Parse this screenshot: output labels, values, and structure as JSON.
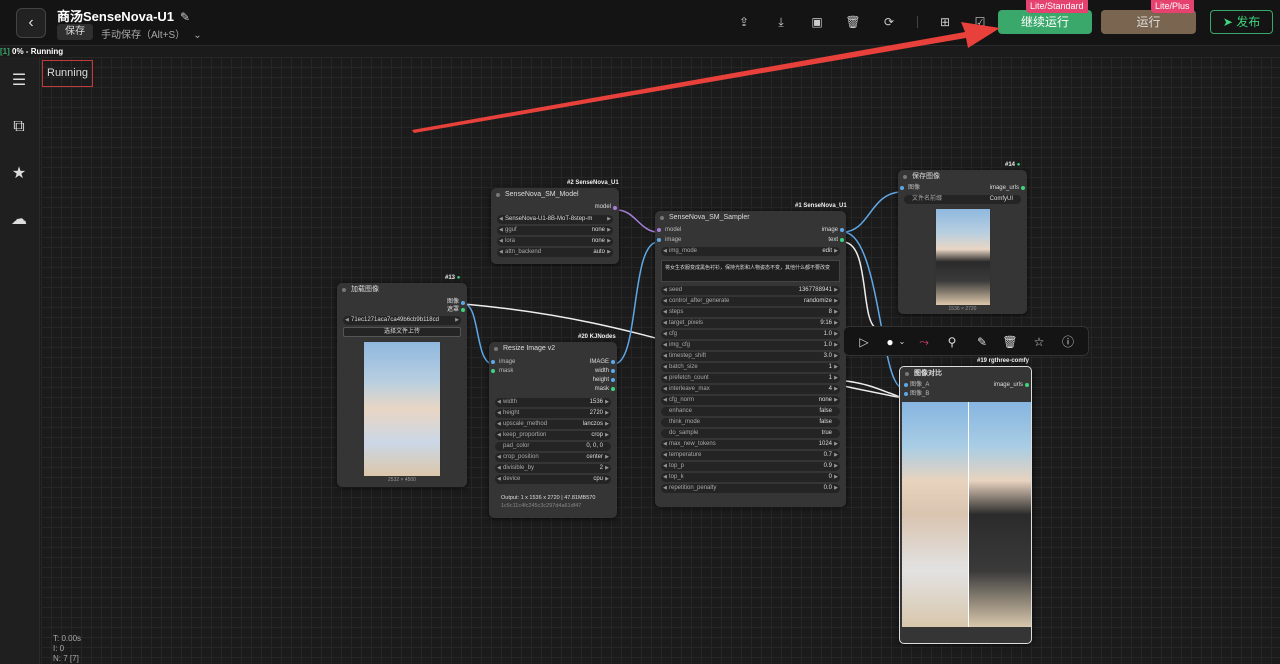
{
  "header": {
    "title": "商汤SenseNova-U1",
    "save_label": "保存",
    "save_hint": "手动保存（Alt+S）",
    "continue_label": "继续运行",
    "continue_ribbon": "Lite/Standard",
    "run_label": "运行",
    "run_ribbon": "Lite/Plus",
    "publish_label": "发布",
    "icons": [
      "upload-icon",
      "download-icon",
      "image-icon",
      "trash-icon",
      "refresh-icon",
      "grid-icon",
      "edit-box-icon"
    ]
  },
  "progress": {
    "tag": "[1]",
    "text": "0% - Running"
  },
  "running_label": "Running",
  "sidebar": {
    "icons": [
      "document-icon",
      "hierarchy-icon",
      "star-icon",
      "cloud-icon"
    ]
  },
  "stats": {
    "t": "T: 0.00s",
    "i": "I: 0",
    "n": "N: 7 [7]"
  },
  "nodes": {
    "load_image": {
      "tag": "#13",
      "title": "加载图像",
      "out1": "图像",
      "out2": "遮罩",
      "file": "71ec1271aca7ca49b6cb9b118cd",
      "upload": "选择文件上传",
      "caption": "2532 × 4500"
    },
    "model": {
      "tag": "#2 SenseNova_U1",
      "title": "SenseNova_SM_Model",
      "out": "model",
      "widgets": [
        {
          "label": "SenseNova-U1-8B-MoT-8step-m",
          "value": ""
        },
        {
          "label": "gguf",
          "value": "none"
        },
        {
          "label": "lora",
          "value": "none"
        },
        {
          "label": "attn_backend",
          "value": "auto"
        }
      ]
    },
    "resize": {
      "tag": "#20 KJNodes",
      "title": "Resize Image v2",
      "inputs": [
        "image",
        "mask"
      ],
      "outputs": [
        "IMAGE",
        "width",
        "height",
        "mask"
      ],
      "widgets": [
        {
          "label": "width",
          "value": "1536"
        },
        {
          "label": "height",
          "value": "2720"
        },
        {
          "label": "upscale_method",
          "value": "lanczos"
        },
        {
          "label": "keep_proportion",
          "value": "crop"
        },
        {
          "label": "pad_color",
          "value": "0, 0, 0"
        },
        {
          "label": "crop_position",
          "value": "center"
        },
        {
          "label": "divisible_by",
          "value": "2"
        },
        {
          "label": "device",
          "value": "cpu"
        }
      ],
      "output_text": "Output: 1 x 1536 x 2720 | 47.81MB570",
      "output_text2": "1c6c11c4fc245c3c297d4a61df47"
    },
    "sampler": {
      "tag": "#1 SenseNova_U1",
      "title": "SenseNova_SM_Sampler",
      "inputs": [
        "model",
        "image"
      ],
      "outputs": [
        "image",
        "text"
      ],
      "mode": {
        "label": "img_mode",
        "value": "edit"
      },
      "prompt": "将女生衣服变成黑色衬衫，保持光影和人物姿态不变，其他什么都不要改变",
      "widgets": [
        {
          "label": "seed",
          "value": "1367788941"
        },
        {
          "label": "control_after_generate",
          "value": "randomize"
        },
        {
          "label": "steps",
          "value": "8"
        },
        {
          "label": "target_pixels",
          "value": "9:16"
        },
        {
          "label": "cfg",
          "value": "1.0"
        },
        {
          "label": "img_cfg",
          "value": "1.0"
        },
        {
          "label": "timestep_shift",
          "value": "3.0"
        },
        {
          "label": "batch_size",
          "value": "1"
        },
        {
          "label": "prefetch_count",
          "value": "1"
        },
        {
          "label": "interleave_max",
          "value": "4"
        },
        {
          "label": "cfg_norm",
          "value": "none"
        },
        {
          "label": "enhance",
          "value": "false"
        },
        {
          "label": "think_mode",
          "value": "false"
        },
        {
          "label": "do_sample",
          "value": "true"
        },
        {
          "label": "max_new_tokens",
          "value": "1024"
        },
        {
          "label": "temperature",
          "value": "0.7"
        },
        {
          "label": "top_p",
          "value": "0.9"
        },
        {
          "label": "top_k",
          "value": "0"
        },
        {
          "label": "repetition_penalty",
          "value": "0.0"
        }
      ]
    },
    "save": {
      "tag": "#14",
      "title": "保存图像",
      "input": "图像",
      "output": "image_urls",
      "prefix_label": "文件名前缀",
      "prefix_value": "ComfyUI",
      "caption": "1536 × 2720"
    },
    "compare": {
      "tag": "#19 rgthree-comfy",
      "title": "图像对比",
      "inputs": [
        "图像_A",
        "图像_B"
      ],
      "output": "image_urls"
    }
  },
  "floating_toolbar": {
    "icons": [
      "play-icon",
      "color-dot-icon",
      "chevron-down-icon",
      "bypass-icon",
      "pin-icon",
      "pencil-icon",
      "trash-icon",
      "star-icon",
      "help-icon"
    ]
  },
  "colors": {
    "accent_green": "#3aa86a",
    "ribbon_pink": "#e64270",
    "run_brown": "#7a6650",
    "arrow_red": "#e8403a",
    "link_blue": "#5fa8e8",
    "link_purple": "#a77ed8"
  }
}
